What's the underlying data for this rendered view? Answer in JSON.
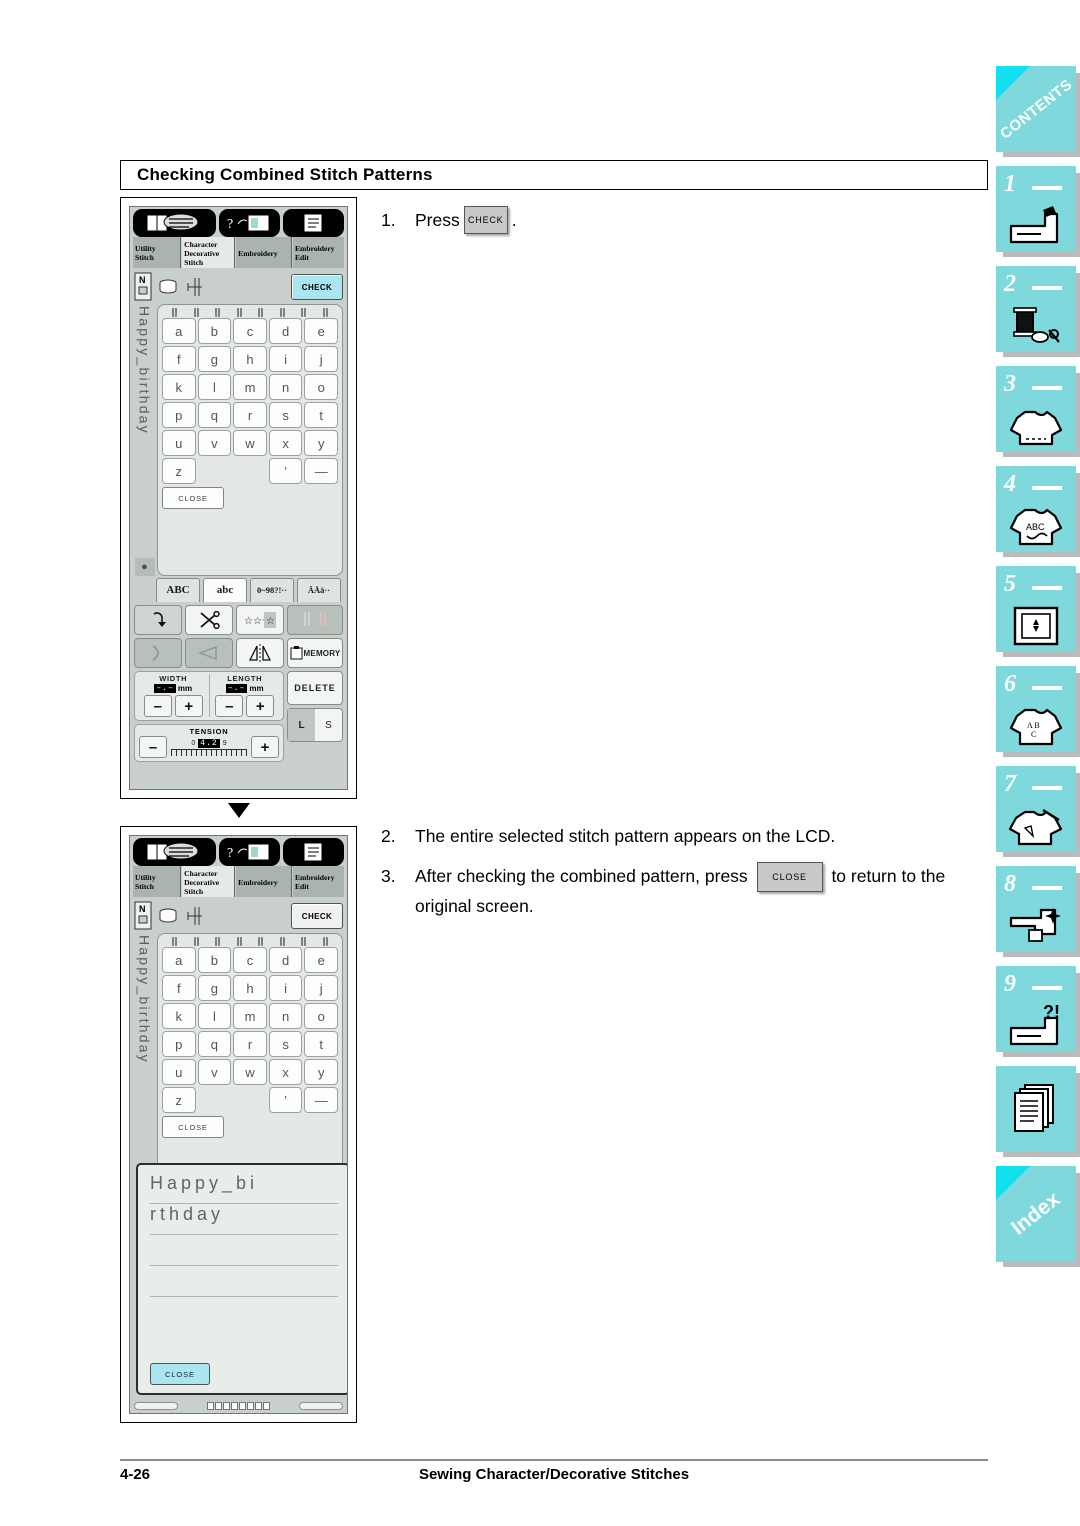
{
  "section": {
    "heading": "Checking Combined Stitch Patterns"
  },
  "footer": {
    "page_number": "4-26",
    "title": "Sewing Character/Decorative Stitches"
  },
  "steps": {
    "s1_num": "1.",
    "s1_text": "Press",
    "s1_button": "CHECK",
    "s1_period": ".",
    "s2_num": "2.",
    "s2_text": "The entire selected stitch pattern appears on the LCD.",
    "s3_num": "3.",
    "s3_text_before": "After checking the combined pattern, press",
    "s3_button": "CLOSE",
    "s3_text_after": "to return to the original screen."
  },
  "lcd": {
    "tabs": [
      {
        "line1": "Utility",
        "line2": "Stitch",
        "line3": "",
        "active": false
      },
      {
        "line1": "Character",
        "line2": "Decorative",
        "line3": "Stitch",
        "active": true
      },
      {
        "line1": "Embroidery",
        "line2": "",
        "line3": "",
        "active": false
      },
      {
        "line1": "Embroidery",
        "line2": "Edit",
        "line3": "",
        "active": false
      }
    ],
    "presser_foot_label": "N",
    "check_button": "CHECK",
    "entered_text": "Happy_birthday",
    "keys": [
      "a",
      "b",
      "c",
      "d",
      "e",
      "f",
      "g",
      "h",
      "i",
      "j",
      "k",
      "l",
      "m",
      "n",
      "o",
      "p",
      "q",
      "r",
      "s",
      "t",
      "u",
      "v",
      "w",
      "x",
      "y",
      "z",
      "",
      "",
      "’",
      "—"
    ],
    "keyboard_close": "CLOSE",
    "charset_tabs": [
      {
        "label": "ABC",
        "active": false
      },
      {
        "label": "abc",
        "active": true
      },
      {
        "label": "0~9",
        "label2": "8?!··",
        "active": false
      },
      {
        "label": "ÄÅä··",
        "label2": "",
        "active": false
      }
    ],
    "memory_label": "MEMORY",
    "delete_label": "DELETE",
    "size_l": "L",
    "size_s": "S",
    "width": {
      "title": "WIDTH",
      "value": "–.–",
      "unit": "mm",
      "minus": "–",
      "plus": "+"
    },
    "length": {
      "title": "LENGTH",
      "value": "–.–",
      "unit": "mm",
      "minus": "–",
      "plus": "+"
    },
    "tension": {
      "title": "TENSION",
      "value": "4.2",
      "min": "0",
      "max": "9",
      "minus": "–",
      "plus": "+"
    }
  },
  "preview": {
    "line1": "Happy_bi",
    "line2": "rthday",
    "line3": "",
    "line4": "",
    "line5": "",
    "close_label": "CLOSE"
  },
  "side_tabs": [
    {
      "name": "contents",
      "label": "CONTENTS",
      "icon": "diagonal-text",
      "number": ""
    },
    {
      "name": "chapter-1",
      "label": "",
      "icon": "sewing-machine-icon",
      "number": "1"
    },
    {
      "name": "chapter-2",
      "label": "",
      "icon": "thread-spool-scissors-icon",
      "number": "2"
    },
    {
      "name": "chapter-3",
      "label": "",
      "icon": "shirt-icon",
      "number": "3"
    },
    {
      "name": "chapter-4",
      "label": "",
      "icon": "shirt-abc-icon",
      "number": "4"
    },
    {
      "name": "chapter-5",
      "label": "",
      "icon": "embroidery-frame-icon",
      "number": "5"
    },
    {
      "name": "chapter-6",
      "label": "",
      "icon": "shirt-letters-icon",
      "number": "6"
    },
    {
      "name": "chapter-7",
      "label": "",
      "icon": "shirt-pencil-icon",
      "number": "7"
    },
    {
      "name": "chapter-8",
      "label": "",
      "icon": "machine-cleaning-icon",
      "number": "8"
    },
    {
      "name": "chapter-9",
      "label": "",
      "icon": "machine-question-icon",
      "number": "9"
    },
    {
      "name": "appendix",
      "label": "",
      "icon": "documents-icon",
      "number": ""
    },
    {
      "name": "index",
      "label": "Index",
      "icon": "diagonal-text",
      "number": ""
    }
  ],
  "colors": {
    "accent_cyan": "#7ed8dc",
    "lcd_highlight": "#a9e6f2",
    "lcd_bg": "#c9cfcb"
  }
}
